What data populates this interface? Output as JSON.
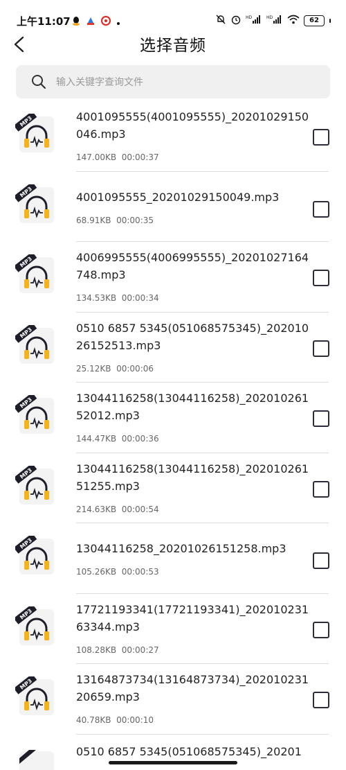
{
  "status_bar": {
    "time": "上午11:07",
    "battery": "62",
    "network_labels": [
      "HD",
      "HD"
    ]
  },
  "header": {
    "title": "选择音频"
  },
  "search": {
    "placeholder": "输入关键字查询文件"
  },
  "files": [
    {
      "name": "4001095555(4001095555)_20201029150046.mp3",
      "size": "147.00KB",
      "duration": "00:00:37",
      "lines": 2
    },
    {
      "name": "4001095555_20201029150049.mp3",
      "size": "68.91KB",
      "duration": "00:00:35",
      "lines": 1
    },
    {
      "name": "4006995555(4006995555)_20201027164748.mp3",
      "size": "134.53KB",
      "duration": "00:00:34",
      "lines": 2
    },
    {
      "name": "0510 6857 5345(051068575345)_20201026152513.mp3",
      "size": "25.12KB",
      "duration": "00:00:06",
      "lines": 2
    },
    {
      "name": "13044116258(13044116258)_20201026152012.mp3",
      "size": "144.47KB",
      "duration": "00:00:36",
      "lines": 2
    },
    {
      "name": "13044116258(13044116258)_20201026151255.mp3",
      "size": "214.63KB",
      "duration": "00:00:54",
      "lines": 2
    },
    {
      "name": "13044116258_20201026151258.mp3",
      "size": "105.26KB",
      "duration": "00:00:53",
      "lines": 1
    },
    {
      "name": "17721193341(17721193341)_20201023163344.mp3",
      "size": "108.28KB",
      "duration": "00:00:27",
      "lines": 2
    },
    {
      "name": "13164873734(13164873734)_20201023120659.mp3",
      "size": "40.78KB",
      "duration": "00:00:10",
      "lines": 2
    }
  ],
  "partial_file": {
    "name": "0510 6857 5345(051068575345)_20201"
  },
  "icon_badge": "MP3",
  "colors": {
    "accent": "#f5b21a",
    "icon_dark": "#1e1e2a",
    "checkbox": "#2b2b3a"
  }
}
